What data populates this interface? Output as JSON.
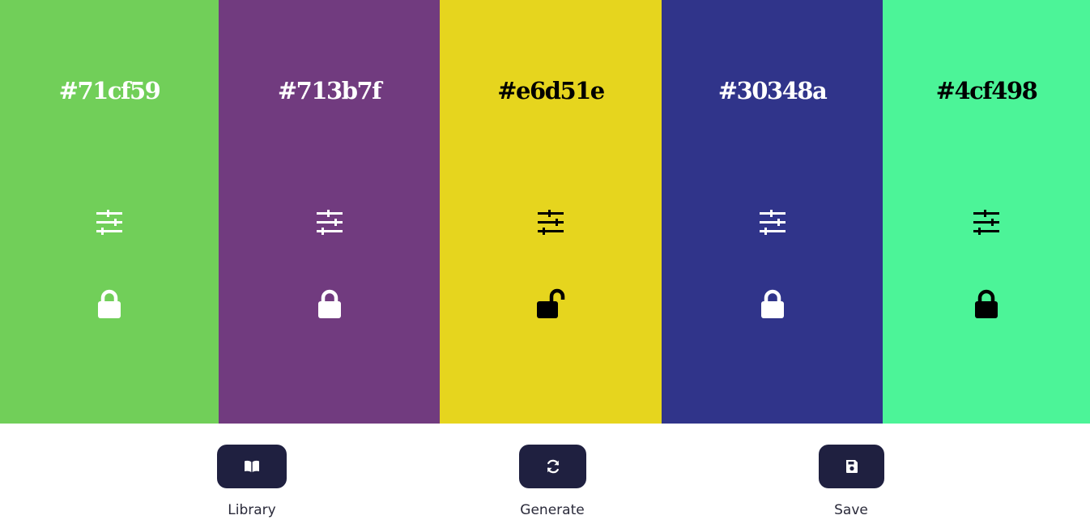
{
  "palette": {
    "swatches": [
      {
        "hex": "#71cf59",
        "text_color": "#ffffff",
        "locked": true
      },
      {
        "hex": "#713b7f",
        "text_color": "#ffffff",
        "locked": true
      },
      {
        "hex": "#e6d51e",
        "text_color": "#000000",
        "locked": false
      },
      {
        "hex": "#30348a",
        "text_color": "#ffffff",
        "locked": true
      },
      {
        "hex": "#4cf498",
        "text_color": "#000000",
        "locked": true
      }
    ]
  },
  "controls": {
    "library": {
      "label": "Library",
      "icon": "book-open-icon"
    },
    "generate": {
      "label": "Generate",
      "icon": "refresh-icon"
    },
    "save": {
      "label": "Save",
      "icon": "floppy-disk-icon"
    },
    "button_color": "#1f2040"
  }
}
